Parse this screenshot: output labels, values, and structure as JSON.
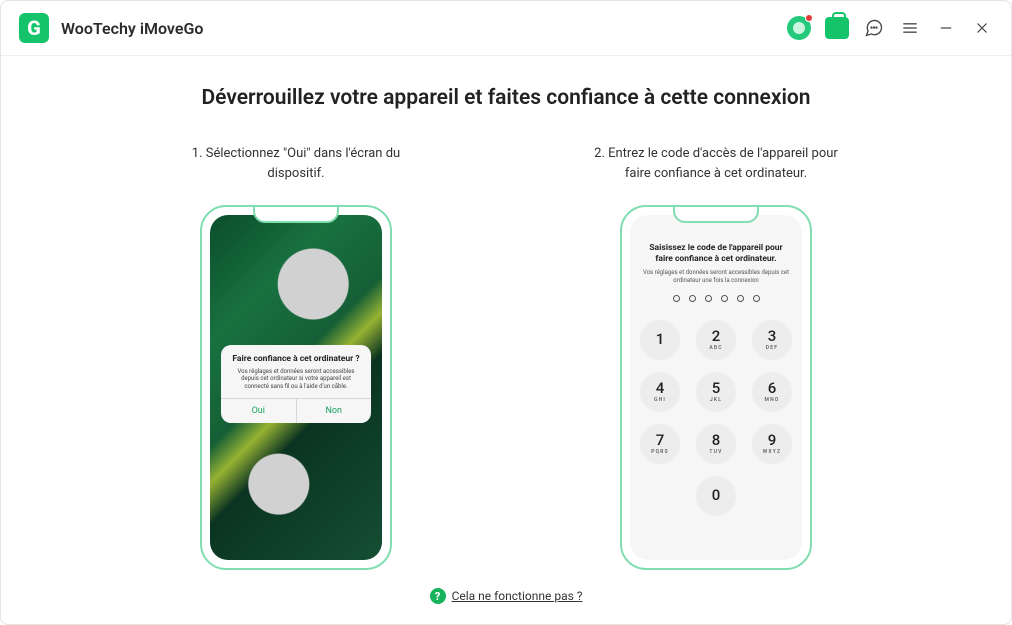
{
  "header": {
    "app_title": "WooTechy iMoveGo",
    "logo_letter": "G"
  },
  "page": {
    "title": "Déverrouillez votre appareil et faites confiance à cette connexion",
    "help_link": "Cela ne fonctionne pas ?"
  },
  "step1": {
    "instruction": "1. Sélectionnez \"Oui\" dans l'écran du dispositif.",
    "dialog_title": "Faire confiance à cet ordinateur ?",
    "dialog_message": "Vos réglages et données seront accessibles depuis cet ordinateur si votre appareil est connecté sans fil ou à l'aide d'un câble.",
    "btn_yes": "Oui",
    "btn_no": "Non"
  },
  "step2": {
    "instruction": "2. Entrez le code d'accès de l'appareil pour faire confiance à cet ordinateur.",
    "pass_title": "Saisissez le code de l'appareil pour faire confiance à cet ordinateur.",
    "pass_sub": "Vos réglages et données seront accessibles depuis cet ordinateur une fois la connexion",
    "keys": {
      "k1n": "1",
      "k1l": "",
      "k2n": "2",
      "k2l": "ABC",
      "k3n": "3",
      "k3l": "DEF",
      "k4n": "4",
      "k4l": "GHI",
      "k5n": "5",
      "k5l": "JKL",
      "k6n": "6",
      "k6l": "MNO",
      "k7n": "7",
      "k7l": "PQRS",
      "k8n": "8",
      "k8l": "TUV",
      "k9n": "9",
      "k9l": "WXYZ",
      "k0n": "0",
      "k0l": ""
    }
  }
}
